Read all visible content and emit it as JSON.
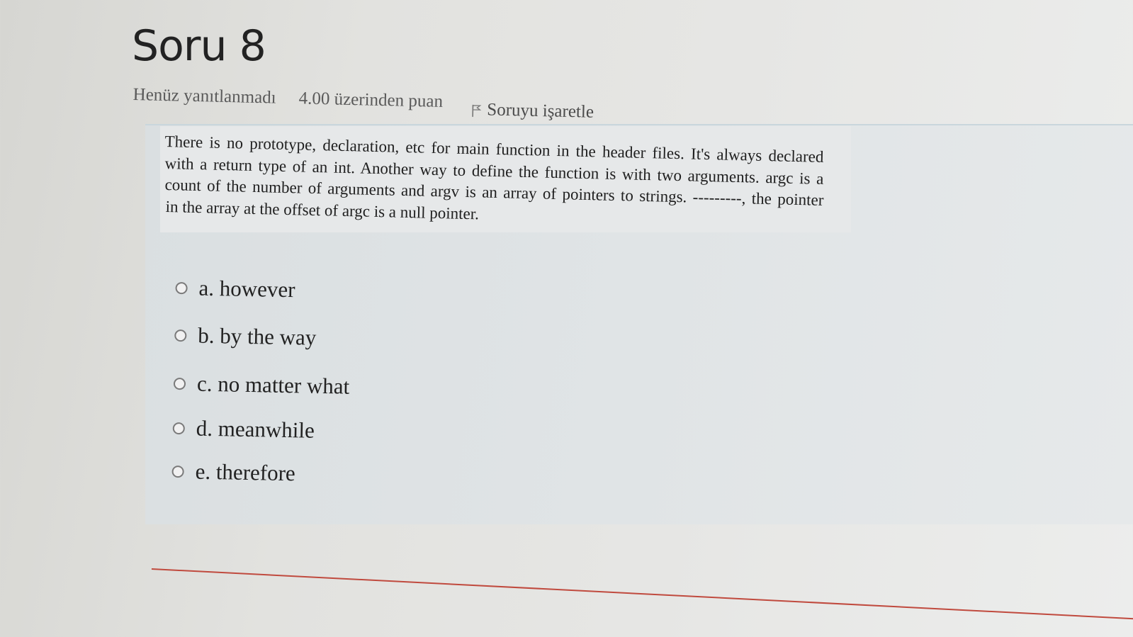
{
  "question": {
    "title": "Soru 8",
    "state": "Henüz yanıtlanmadı",
    "grade": "4.00 üzerinden puan",
    "flag_label": "Soruyu işaretle",
    "text_lines": [
      "There is no prototype, declaration, etc for main function in the header files. It's always declared",
      "with a return type of an int. Another way to define the function is with two arguments. argc is a",
      "count of the number of arguments and argv is an array of pointers to strings. ---------, the pointer",
      "in the array at the offset of argc is a null pointer."
    ]
  },
  "answers": [
    {
      "label": "a. however",
      "selected": false
    },
    {
      "label": "b. by the way",
      "selected": false
    },
    {
      "label": "c. no matter what",
      "selected": false
    },
    {
      "label": "d. meanwhile",
      "selected": false
    },
    {
      "label": "e. therefore",
      "selected": false
    }
  ],
  "colors": {
    "divider": "#c04a3e",
    "panel": "#dfe3e5"
  },
  "icons": {
    "flag": "flag-icon",
    "radio": "radio-icon"
  }
}
